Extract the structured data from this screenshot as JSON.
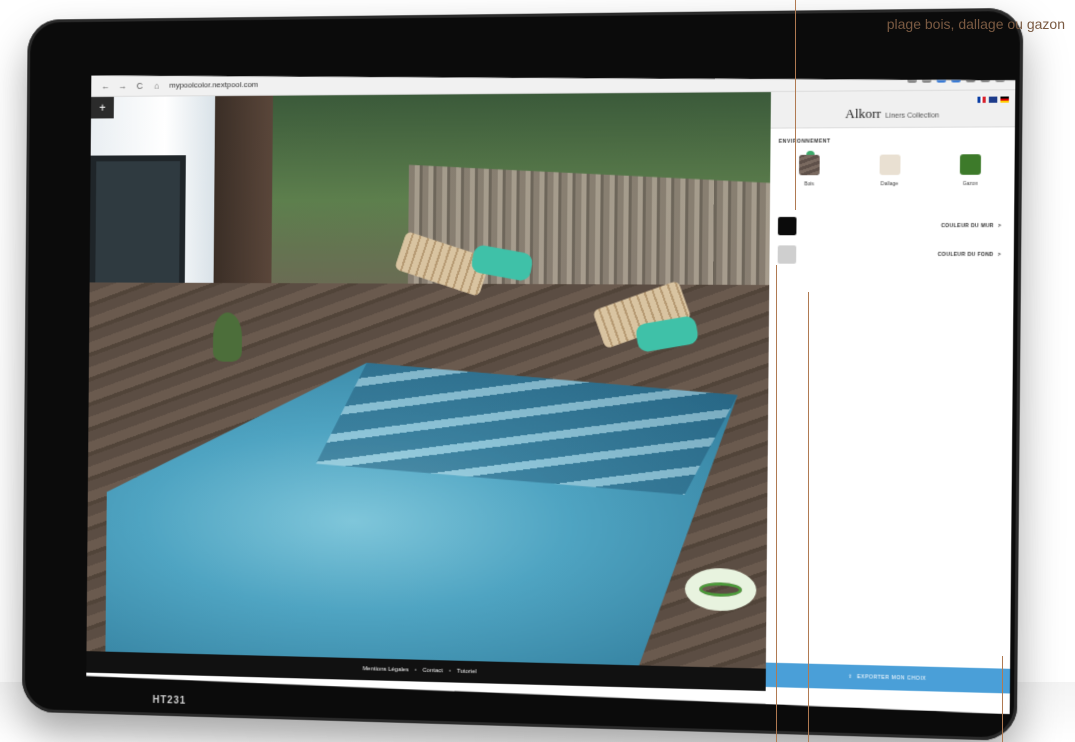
{
  "caption": "plage bois, dallage ou gazon",
  "browser": {
    "url": "mypoolcolor.nextpool.com",
    "back": "←",
    "forward": "→",
    "reload": "C",
    "home": "⌂"
  },
  "scene": {
    "add_button": "+"
  },
  "panel": {
    "logo": "Alkorr",
    "logo_sub": "Liners Collection",
    "environment_title": "ENVIRONNEMENT",
    "environment_options": [
      {
        "label": "Bois"
      },
      {
        "label": "Dallage"
      },
      {
        "label": "Gazon"
      }
    ],
    "wall_color_label": "COULEUR DU MUR",
    "floor_color_label": "COULEUR DU FOND",
    "chevron": ">",
    "export_label": "EXPORTER MON CHOIX",
    "export_icon": "⇪"
  },
  "footer": {
    "legal": "Mentions Légales",
    "contact": "Contact",
    "tutorial": "Tutoriel",
    "separator": "•"
  },
  "device": {
    "model": "HT231"
  },
  "colors": {
    "wall_swatch": "#0b0b0b",
    "floor_swatch": "#cfcfcf",
    "export_button": "#4a9fd8",
    "selected_indicator": "#3caa6b"
  }
}
